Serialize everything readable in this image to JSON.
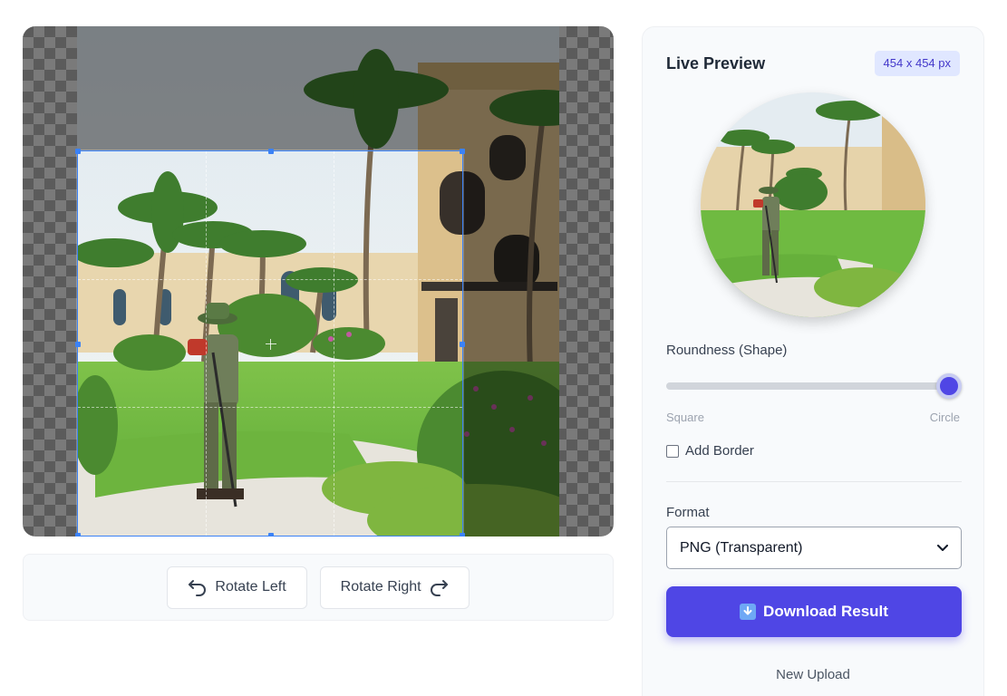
{
  "editor": {
    "image_alt": "Gardener trimming lawn with palm trees and buildings"
  },
  "toolbar": {
    "rotate_left_label": "Rotate Left",
    "rotate_right_label": "Rotate Right"
  },
  "panel": {
    "title": "Live Preview",
    "size_badge": "454 x 454 px",
    "roundness_label": "Roundness (Shape)",
    "roundness_value": 1.0,
    "slider_min_label": "Square",
    "slider_max_label": "Circle",
    "add_border_label": "Add Border",
    "add_border_checked": false,
    "format_label": "Format",
    "format_selected": "PNG (Transparent)",
    "download_label": "Download Result",
    "new_upload_label": "New Upload"
  },
  "colors": {
    "accent": "#4f46e5",
    "crop_border": "#3b82f6",
    "badge_bg": "#e0e7ff",
    "badge_text": "#4338ca"
  },
  "icons": {
    "rotate_left": "rotate-left-icon",
    "rotate_right": "rotate-right-icon",
    "download": "download-icon",
    "select_chevron": "chevron-down-icon"
  }
}
